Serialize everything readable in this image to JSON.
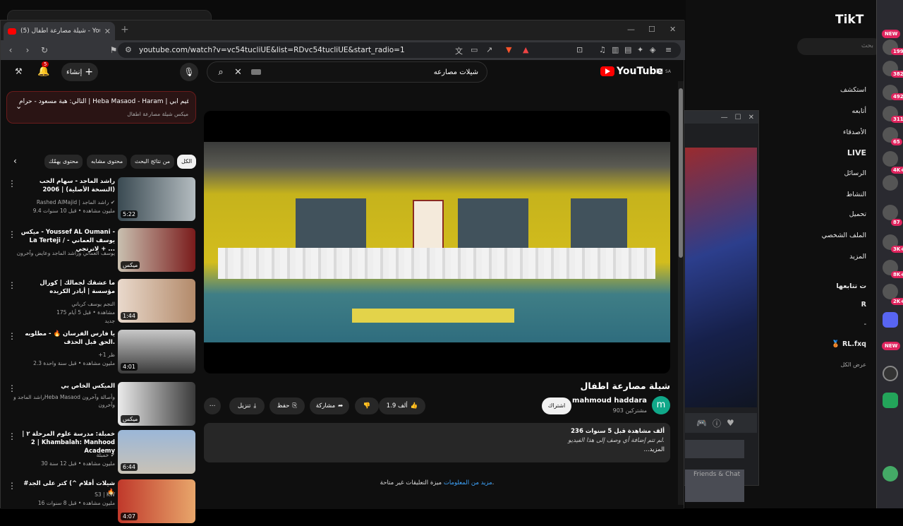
{
  "browser": {
    "tab_title": "(5) شيلة مصارعة اطفال - YouTube",
    "new_tab": "+",
    "url": "youtube.com/watch?v=vc54tucliUE&list=RDvc54tucliUE&start_radio=1",
    "win_min": "—",
    "win_max": "☐",
    "win_close": "✕"
  },
  "youtube": {
    "create_label": "إنشاء",
    "notif_count": "5",
    "search_query": "شيلات مصارعه",
    "logo_text": "YouTube",
    "logo_region": "SA",
    "next_up": {
      "title": "التالي: هبة مسعود - حرام | Heba Masaod - Haram | اقيم أبي ...",
      "subtitle": "ميكس شيلة مصارعة اطفال"
    },
    "chips": [
      "الكل",
      "من نتائج البحث",
      "محتوى مشابه",
      "محتوى يهمّك"
    ],
    "video": {
      "title": "شيلة مصارعة اطفال",
      "channel": "mahmoud haddara",
      "channel_initial": "m",
      "subscribers": "903 مشتركين",
      "subscribe_label": "اشتراك",
      "likes": "1.9 ألف",
      "share_label": "مشاركة",
      "save_label": "حفظ",
      "download_label": "تنزيل",
      "views_line": "236 ألف مشاهدة  قبل 5 سنوات",
      "no_desc": "لم تتم إضافة أي وصف إلى هذا الفيديو.",
      "more": "...المزيد",
      "comments_off": "ميزة التعليقات غير متاحة.",
      "more_info": "مزيد من المعلومات"
    },
    "recommendations": [
      {
        "title": "راشد الماجد - سهام الحب (النسخة الأصلية) | 2006",
        "channel": "Rashed AlMajid | راشد الماجد ✔",
        "stats": "9.4 مليون مشاهدة • قبل 10 سنوات",
        "duration": "5:22"
      },
      {
        "title": "ميكس - Youssef AL Oumani - La Terteji / يوسف العماني - لاترتجي + ...",
        "channel": "يوسف العماني وراشد الماجد وعايض وآخرون",
        "stats": "",
        "duration": "ميكس"
      },
      {
        "title": "ما عشقك لجمالك | كورال مؤسسة | أبادر الكريده",
        "channel": "النجم يوسف كرباني",
        "stats": "175 مشاهدة • قبل 5 أيام",
        "badge": "جديد",
        "duration": "1:44"
      },
      {
        "title": "يا فارس الفرسان 🔥 - مطلوبه الحق قبل الحذف.",
        "channel": "+ظر 1",
        "stats": "2.3 مليون مشاهدة • قبل سنة واحدة",
        "duration": "4:01"
      },
      {
        "title": "الميكس الخاص بي",
        "channel": "راشد الماجد وHeba Masaod وأصالة وآخرون وآخرون",
        "stats": "",
        "duration": "ميكس"
      },
      {
        "title": "خمبلة: مدرسة علوم المرحلة ٢ | 2 | Khambalah: Manhood Academy",
        "channel": "خمبلة ✔",
        "stats": "30 مليون مشاهدة • قبل 12 سنة",
        "duration": "6:44"
      },
      {
        "title": "#شيلات أفلام ^) كتر على الجد 🔥",
        "channel": "S3 | KW",
        "stats": "16 مليون مشاهدة • قبل 8 سنوات",
        "duration": "4:07"
      }
    ]
  },
  "tiktok": {
    "logo": "TikT",
    "search": "بحث",
    "nav": [
      "استكشف",
      "أتابعه",
      "الأصدقاء",
      "LIVE",
      "الرسائل",
      "النشاط",
      "تحميل",
      "الملف الشخصي",
      "المزيد"
    ],
    "following_header": "ت تتابعها",
    "following": [
      "R",
      "-",
      "🥉 RL.fxq"
    ],
    "show_all": "عرض الكل"
  },
  "mini_window": {
    "friends_chat": "Friends & Chat"
  },
  "strip": {
    "badges": [
      "199",
      "382",
      "492",
      "311",
      "65",
      "4K+",
      "87",
      "3K+",
      "8K+",
      "2K+"
    ],
    "new_label": "NEW"
  },
  "colors": {
    "yt_red": "#ff0000",
    "accent_link": "#3ea6ff",
    "badge_pink": "#e0245e"
  }
}
